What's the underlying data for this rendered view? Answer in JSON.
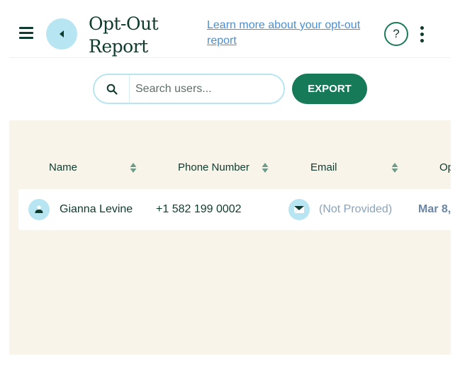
{
  "header": {
    "title": "Opt-Out Report",
    "learn_more_link": "Learn more about your opt-out report",
    "help_label": "?"
  },
  "search": {
    "placeholder": "Search users...",
    "value": ""
  },
  "toolbar": {
    "export_label": "EXPORT"
  },
  "table": {
    "columns": [
      {
        "label": "Name",
        "sortable": true
      },
      {
        "label": "Phone Number",
        "sortable": true
      },
      {
        "label": "Email",
        "sortable": true
      },
      {
        "label": "Op",
        "sortable": false
      }
    ],
    "rows": [
      {
        "name": "Gianna Levine",
        "phone": "+1 582 199 0002",
        "email": "(Not Provided)",
        "opt_out_date": "Mar 8,"
      }
    ]
  },
  "colors": {
    "primary": "#167a59",
    "accent_light": "#b8e5f2",
    "panel_bg": "#f8f4ea",
    "text_dark": "#0e3b2e",
    "link": "#4a8fd4",
    "muted": "#8aa3bd"
  }
}
